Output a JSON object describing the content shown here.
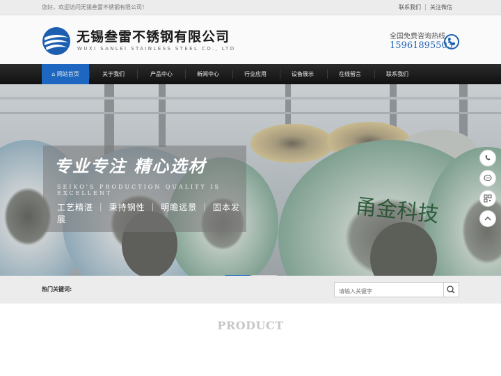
{
  "topbar": {
    "welcome": "您好，欢迎访问无锡叁雷不锈钢有限公司！",
    "links": [
      "联系我们",
      "关注微信"
    ]
  },
  "header": {
    "brand_cn": "无锡叁雷不锈钢有限公司",
    "brand_en": "WUXI SANLEI STAINLESS STEEL CO., LTD",
    "logo_icon": "swirl-logo-icon",
    "hotline_label": "全国免费咨询热线",
    "hotline_number": "15961895503",
    "phone_icon": "phone-icon"
  },
  "nav": {
    "items": [
      {
        "label": "网站首页",
        "icon": "home-icon",
        "active": true
      },
      {
        "label": "关于我们"
      },
      {
        "label": "产品中心"
      },
      {
        "label": "新闻中心"
      },
      {
        "label": "行业应用"
      },
      {
        "label": "设备展示"
      },
      {
        "label": "在线留言"
      },
      {
        "label": "联系我们"
      }
    ],
    "active_color": "#1d67c0"
  },
  "banner": {
    "slogan_main": "专业专注 精心选材",
    "slogan_en": "SEIKO'S PRODUCTION QUALITY IS EXCELLENT",
    "slogan_sub": "工艺精湛 ｜ 秉持钢性 ｜ 明瞻远景 ｜ 固本发展",
    "coil_text": "甬金科技",
    "slides": 2,
    "active_slide": 1
  },
  "float_tools": [
    "phone-icon",
    "chat-icon",
    "qrcode-icon",
    "back-to-top-icon"
  ],
  "search": {
    "hot_keywords_label": "热门关键词:",
    "placeholder": "请输入关键字",
    "icon": "search-icon"
  },
  "section": {
    "title": "PRODUCT"
  }
}
